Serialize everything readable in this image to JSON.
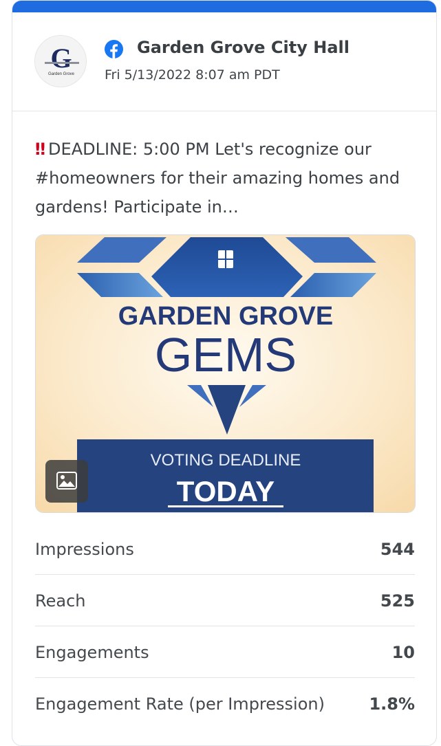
{
  "post": {
    "account_name": "Garden Grove City Hall",
    "platform_icon": "facebook-icon",
    "timestamp": "Fri 5/13/2022 8:07 am PDT",
    "avatar": {
      "letter": "G",
      "caption": "Garden Grove"
    },
    "alert_emoji": "‼",
    "text": "DEADLINE: 5:00 PM Let's recognize our #homeowners for their amazing homes and gardens! Participate in…",
    "image": {
      "headline": "GARDEN GROVE",
      "title": "GEMS",
      "banner_line1": "VOTING DEADLINE",
      "banner_line2": "TODAY",
      "badge_icon": "image-icon"
    }
  },
  "stats": [
    {
      "label": "Impressions",
      "value": "544"
    },
    {
      "label": "Reach",
      "value": "525"
    },
    {
      "label": "Engagements",
      "value": "10"
    },
    {
      "label": "Engagement Rate (per Impression)",
      "value": "1.8%"
    }
  ],
  "colors": {
    "accent_bar": "#1f6be0",
    "facebook_blue": "#1877f2",
    "gem_navy": "#24437f",
    "alert_red": "#d0021b"
  }
}
